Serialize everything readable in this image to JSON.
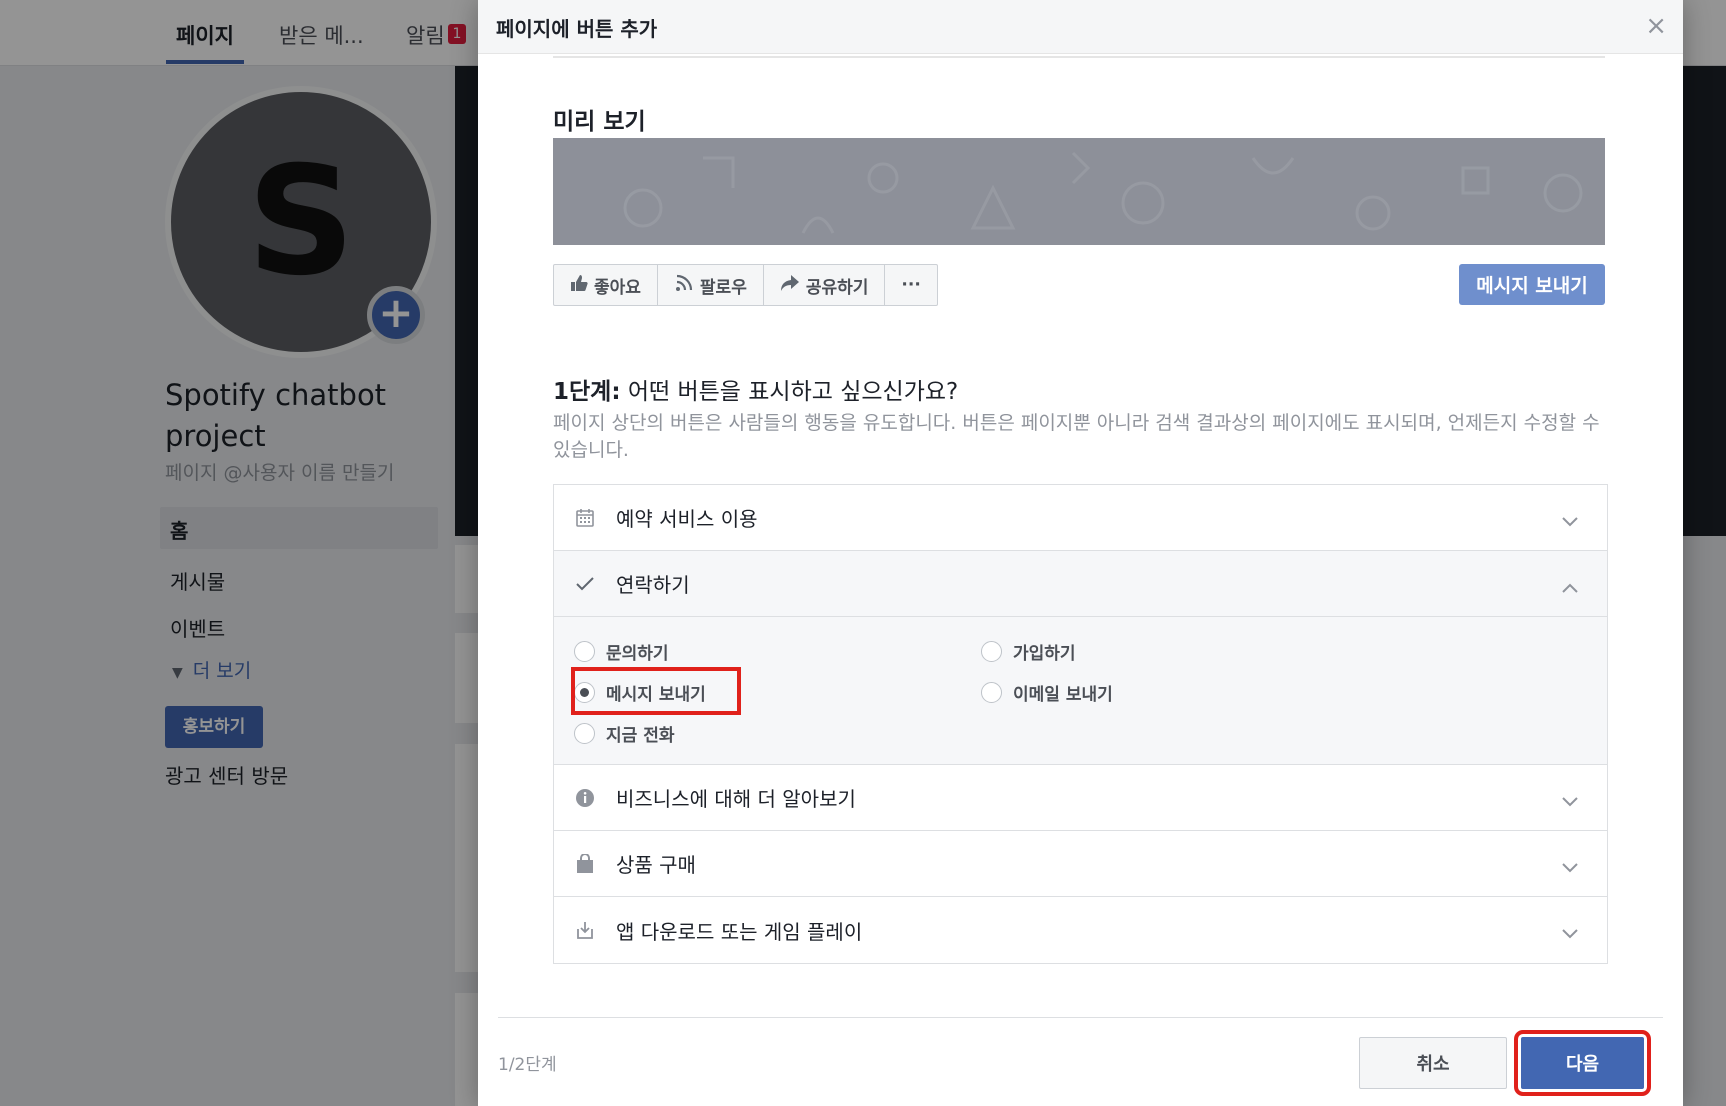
{
  "background": {
    "tabs": [
      {
        "label": "페이지"
      },
      {
        "label": "받은 메..."
      },
      {
        "label": "알림"
      }
    ],
    "notification_count": "1",
    "avatar_letter": "S",
    "page_name": "Spotify chatbot project",
    "page_handle": "페이지 @사용자 이름 만들기",
    "nav": {
      "home": "홈",
      "posts": "게시물",
      "events": "이벤트",
      "more": "더 보기"
    },
    "promote_label": "홍보하기",
    "ads_center": "광고 센터 방문"
  },
  "modal": {
    "title": "페이지에 버튼 추가",
    "close_glyph": "×",
    "preview_label": "미리 보기",
    "preview_actions": {
      "like": "좋아요",
      "follow": "팔로우",
      "share": "공유하기",
      "more": "···"
    },
    "preview_button": "메시지 보내기",
    "step_label": "1단계:",
    "step_question": "어떤 버튼을 표시하고 싶으신가요?",
    "step_desc": "페이지 상단의 버튼은 사람들의 행동을 유도합니다. 버튼은 페이지뿐 아니라 검색 결과상의 페이지에도 표시되며, 언제든지 수정할 수 있습니다.",
    "categories": [
      {
        "label": "예약 서비스 이용",
        "icon": "calendar-icon",
        "expanded": false
      },
      {
        "label": "연락하기",
        "icon": "checkmark-icon",
        "expanded": true
      },
      {
        "label": "비즈니스에 대해 더 알아보기",
        "icon": "info-icon",
        "expanded": false
      },
      {
        "label": "상품 구매",
        "icon": "shopping-bag-icon",
        "expanded": false
      },
      {
        "label": "앱 다운로드 또는 게임 플레이",
        "icon": "download-icon",
        "expanded": false
      }
    ],
    "contact_options": {
      "inquiry": "문의하기",
      "send_message": "메시지 보내기",
      "call_now": "지금 전화",
      "sign_up": "가입하기",
      "send_email": "이메일 보내기"
    },
    "selected_option": "메시지 보내기",
    "step_count": "1/2단계",
    "cancel_label": "취소",
    "next_label": "다음"
  },
  "colors": {
    "brand": "#4267b2",
    "highlight": "#e0211b"
  }
}
